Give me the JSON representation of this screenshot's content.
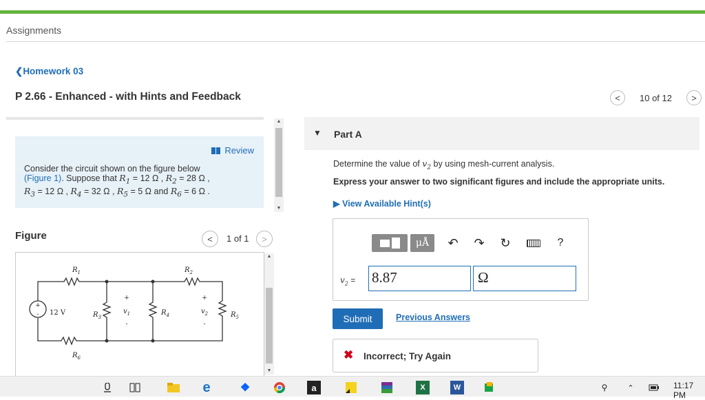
{
  "header": {
    "breadcrumb": "Assignments",
    "back_link": "Homework 03",
    "problem_title": "P 2.66 - Enhanced - with Hints and Feedback",
    "nav_prev_glyph": "<",
    "nav_next_glyph": ">",
    "page_counter": "10 of 12"
  },
  "intro": {
    "review_label": "Review",
    "text_before_link": "Consider the circuit shown on the figure below",
    "link_text": "(Figure 1)",
    "text_after_link": ". Suppose that ",
    "values": [
      {
        "sym": "R",
        "sub": "1",
        "val": "12"
      },
      {
        "sym": "R",
        "sub": "2",
        "val": "28"
      },
      {
        "sym": "R",
        "sub": "3",
        "val": "12"
      },
      {
        "sym": "R",
        "sub": "4",
        "val": "32"
      },
      {
        "sym": "R",
        "sub": "5",
        "val": "5"
      },
      {
        "sym": "R",
        "sub": "6",
        "val": "6"
      }
    ],
    "unit": "Ω",
    "and": "and"
  },
  "figure": {
    "label": "Figure",
    "counter": "1 of 1",
    "source_label": "12 V",
    "r1": "R",
    "r1_sub": "1",
    "r2": "R",
    "r2_sub": "2",
    "r3": "R",
    "r3_sub": "3",
    "r4": "R",
    "r4_sub": "4",
    "r5": "R",
    "r5_sub": "5",
    "r6": "R",
    "r6_sub": "6",
    "v1": "v",
    "v1_sub": "1",
    "v2": "v",
    "v2_sub": "2",
    "plus": "+",
    "minus": "-"
  },
  "part_a": {
    "label": "Part A",
    "question_prefix": "Determine the value of ",
    "question_var": "v",
    "question_var_sub": "2",
    "question_suffix": " by using mesh-current analysis.",
    "instruction": "Express your answer to two significant figures and include the appropriate units.",
    "hint_label": "View Available Hint(s)",
    "toolbar": {
      "units_label": "μÅ",
      "help_label": "?",
      "icons": [
        "templates-icon",
        "units-icon",
        "undo-icon",
        "redo-icon",
        "reset-icon",
        "keyboard-icon",
        "help-icon"
      ]
    },
    "answer_var": "v",
    "answer_var_sub": "2",
    "answer_eq": " =",
    "answer_value": "8.87",
    "answer_unit": "Ω",
    "submit_label": "Submit",
    "previous_answers_label": "Previous Answers",
    "feedback_icon": "✖",
    "feedback_text": "Incorrect; Try Again"
  },
  "taskbar": {
    "clock": "11:17 PM",
    "apps": [
      "a",
      "X",
      "W"
    ],
    "colors": {
      "green": "#63b33d",
      "blue": "#1f6db6",
      "red": "#d0021b"
    }
  }
}
